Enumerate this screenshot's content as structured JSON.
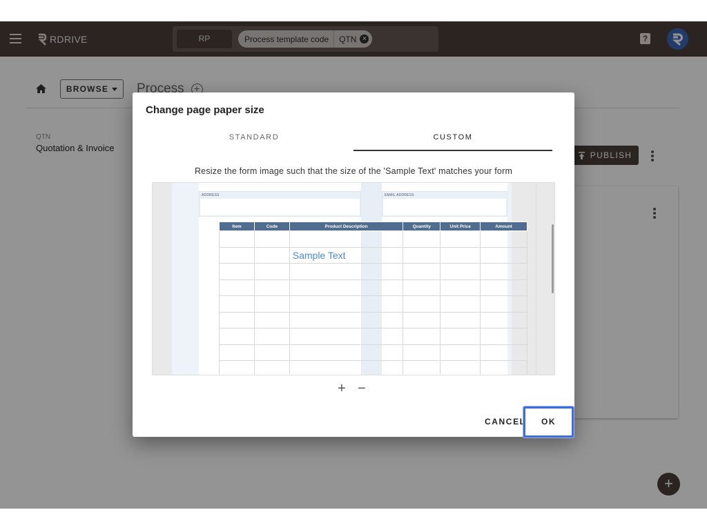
{
  "appbar": {
    "brand_name": "RDRIVE",
    "search_chip_rp": "RP",
    "filter_chip_label": "Process template code",
    "filter_chip_value": "QTN"
  },
  "page": {
    "browse_label": "BROWSE",
    "title": "Process",
    "template_code": "QTN",
    "template_name": "Quotation & Invoice",
    "publish_label": "PUBLISH"
  },
  "dialog": {
    "title": "Change page paper size",
    "tabs": [
      {
        "label": "STANDARD",
        "active": false
      },
      {
        "label": "CUSTOM",
        "active": true
      }
    ],
    "instruction": "Resize the form image such that the size of the 'Sample Text' matches your form",
    "form_preview": {
      "address_label": "ADDRESS",
      "email_label": "EMAIL ADDRESS",
      "columns": [
        "Item",
        "Code",
        "Product Description",
        "Quantity",
        "Unit Price",
        "Amount"
      ],
      "sample_text": "Sample Text"
    },
    "zoom_in_symbol": "+",
    "zoom_out_symbol": "−",
    "cancel_label": "CANCEL",
    "ok_label": "OK"
  },
  "colors": {
    "appbar": "#4a3e38",
    "accent_blue": "#3f6fd6",
    "sample_text": "#4a8ad8",
    "table_header": "#506c8e"
  },
  "icons": [
    "menu-icon",
    "rdrive-logo-icon",
    "close-chip-icon",
    "help-icon",
    "avatar-logo-icon",
    "home-icon",
    "dropdown-caret-icon",
    "add-circle-icon",
    "publish-icon",
    "more-vert-icon",
    "add-fab-icon"
  ]
}
